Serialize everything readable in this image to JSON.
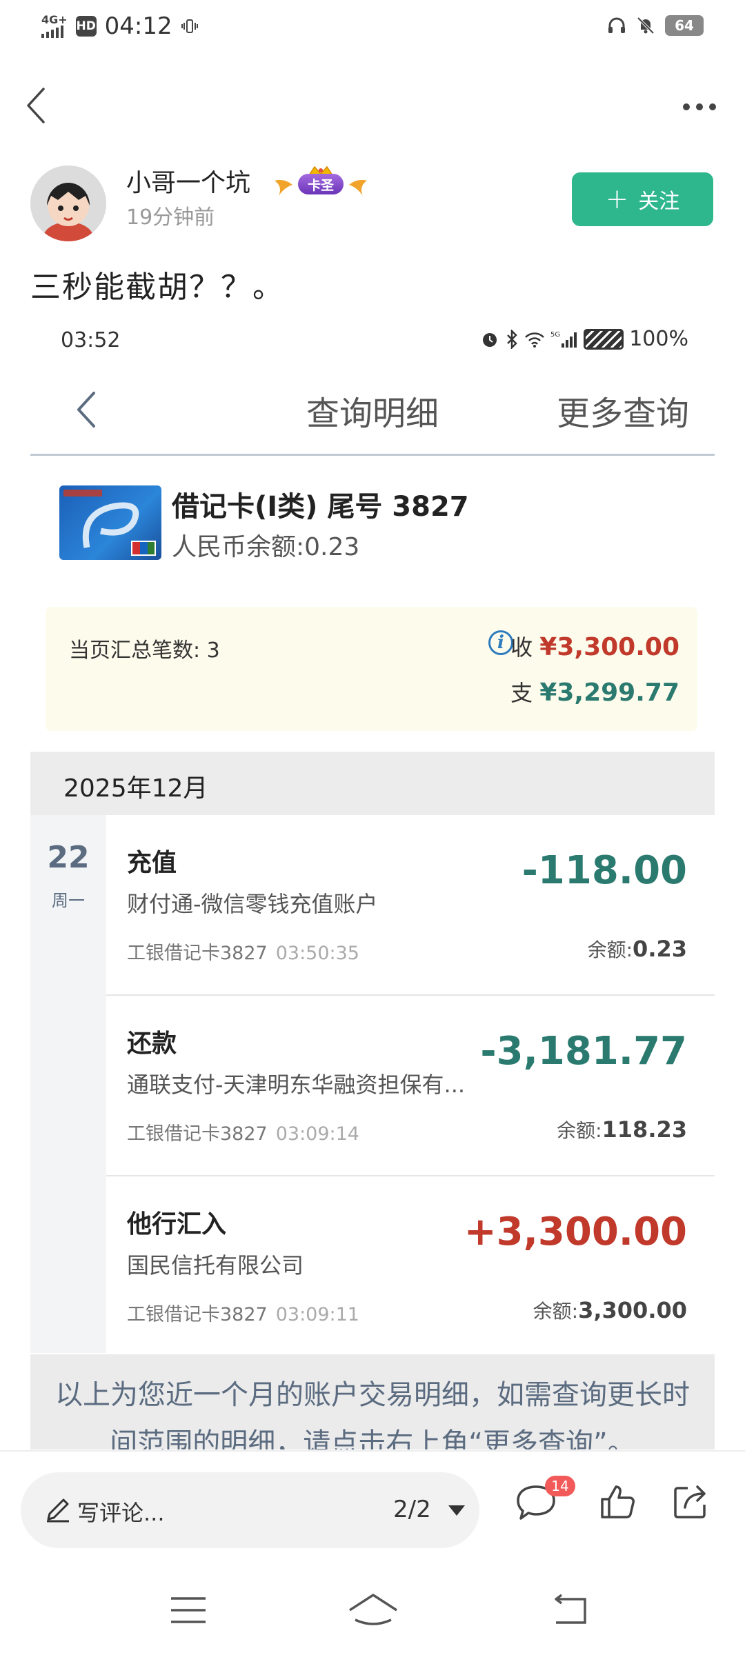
{
  "status_bar": {
    "network": "4G+",
    "hd": "HD",
    "time": "04:12",
    "battery": "64"
  },
  "post": {
    "author": "小哥一个坑",
    "badge": "卡圣",
    "time_ago": "19分钟前",
    "follow_label": "关注",
    "text": "三秒能截胡？？。"
  },
  "shot": {
    "status_time": "03:52",
    "battery_text": "100%",
    "nav_title": "查询明细",
    "nav_more": "更多查询",
    "card_title": "借记卡(I类) 尾号 3827",
    "card_balance": "人民币余额:0.23",
    "summary": {
      "count_label": "当页汇总笔数: 3",
      "in_label": "收",
      "in_amount": "¥3,300.00",
      "out_label": "支",
      "out_amount": "¥3,299.77"
    },
    "month": "2025年12月",
    "date_day": "22",
    "date_weekday": "周一",
    "transactions": [
      {
        "type": "充值",
        "desc": "财付通-微信零钱充值账户",
        "card": "工银借记卡3827",
        "time": "03:50:35",
        "amount": "-118.00",
        "balance_label": "余额:",
        "balance": "0.23"
      },
      {
        "type": "还款",
        "desc": "通联支付-天津明东华融资担保有...",
        "card": "工银借记卡3827",
        "time": "03:09:14",
        "amount": "-3,181.77",
        "balance_label": "余额:",
        "balance": "118.23"
      },
      {
        "type": "他行汇入",
        "desc": "国民信托有限公司",
        "card": "工银借记卡3827",
        "time": "03:09:11",
        "amount": "+3,300.00",
        "balance_label": "余额:",
        "balance": "3,300.00"
      }
    ],
    "footer_note": "以上为您近一个月的账户交易明细，如需查询更长时间范围的明细，请点击右上角“更多查询”。"
  },
  "bottom_bar": {
    "comment_placeholder": "写评论...",
    "page_indicator": "2/2",
    "comment_count": "14"
  },
  "colors": {
    "accent": "#2eb68d",
    "expense": "#2b7a6f",
    "income": "#c0392b"
  }
}
